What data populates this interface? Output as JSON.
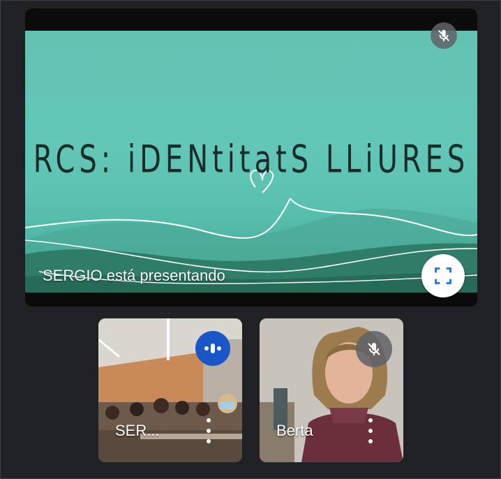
{
  "colors": {
    "background": "#202124",
    "slide": "#62c7b6",
    "speaking_badge": "#1a56c8",
    "muted_badge": "#5f6368"
  },
  "main": {
    "slide_title": "RCS: iDENtitatS LLiURES",
    "presenting_label": "SERGIO está presentando",
    "mic_icon": "mic-off-icon",
    "fullscreen_icon": "fullscreen-icon"
  },
  "participants": [
    {
      "name": "SER...",
      "state": "speaking",
      "icon": "audio-level-icon"
    },
    {
      "name": "Berta",
      "state": "muted",
      "icon": "mic-off-icon"
    }
  ]
}
